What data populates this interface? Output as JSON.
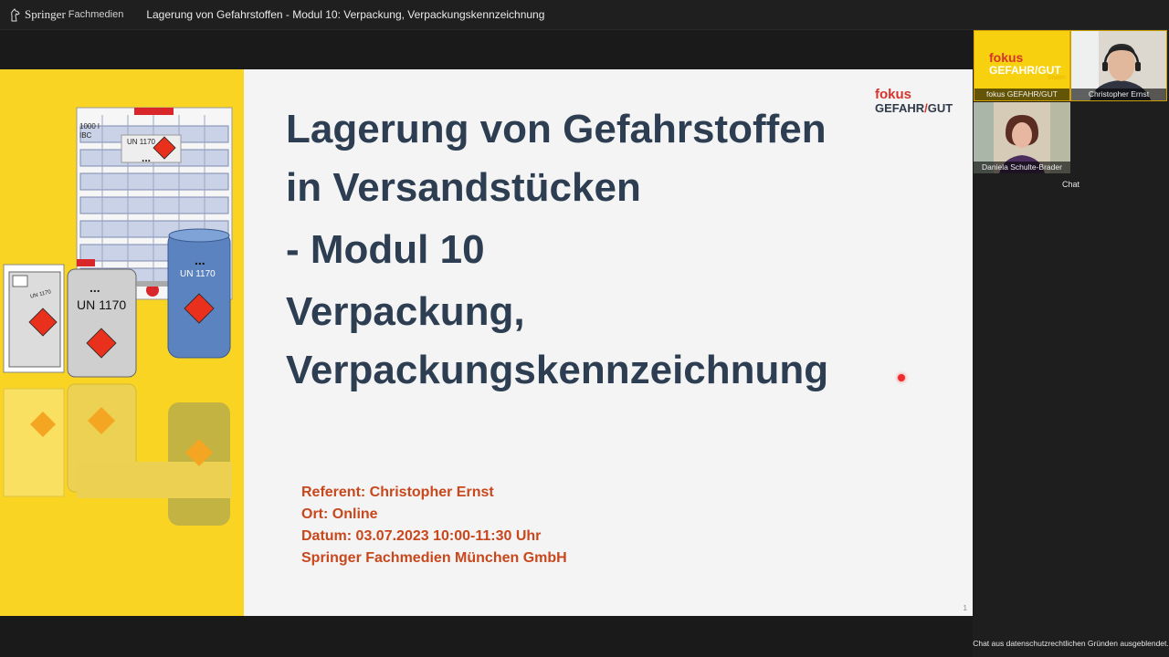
{
  "app": {
    "brand": "Springer",
    "brand_sub": "Fachmedien",
    "window_title": "Lagerung von Gefahrstoffen - Modul 10: Verpackung, Verpackungskennzeichnung"
  },
  "slide": {
    "title_lines": [
      "Lagerung von Gefahrstoffen",
      "in Versandstücken",
      "- Modul 10",
      "Verpackung,",
      "Verpackungskennzeichnung"
    ],
    "info_lines": [
      "Referent: Christopher Ernst",
      "Ort: Online",
      "Datum: 03.07.2023 10:00-11:30 Uhr",
      "Springer Fachmedien München GmbH"
    ],
    "logo_top": "fokus",
    "logo_left": "GEFAHR",
    "logo_slash": "/",
    "logo_right": "GUT",
    "page_number": "1",
    "ibc_label": "1000 l",
    "ibc_label2": "IBC",
    "un_label": "UN 1170",
    "dots": "...",
    "canister_small": "UN 1170"
  },
  "participants": [
    {
      "name": "fokus GEFAHR/GUT",
      "logo_top": "fokus",
      "logo_bottom": "GEFAHR/GUT",
      "logo_sub": "Stuttm"
    },
    {
      "name": "Christopher Ernst"
    },
    {
      "name": "Daniela Schulte-Brader"
    }
  ],
  "chat": {
    "title": "Chat",
    "notice": "Chat aus datenschutzrechtlichen Gründen ausgeblendet."
  },
  "colors": {
    "yellow": "#f9d423",
    "title": "#2e3e52",
    "info": "#c8471c",
    "hazard": "#e8301c"
  }
}
